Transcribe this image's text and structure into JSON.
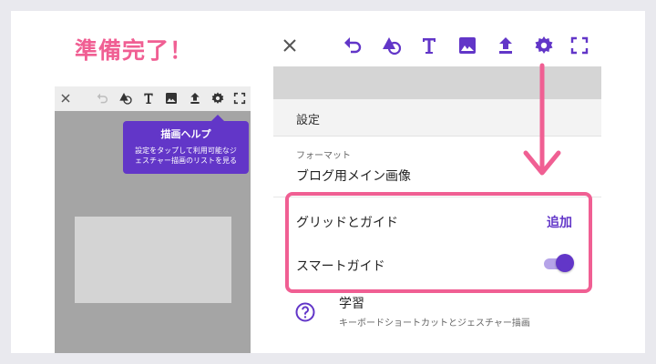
{
  "headline": "準備完了！",
  "tooltip": {
    "title": "描画ヘルプ",
    "line1": "設定をタップして利用可能なジ",
    "line2": "ェスチャー描画のリストを見る"
  },
  "toolbar_icons": [
    "close-icon",
    "undo-icon",
    "shapes-icon",
    "text-icon",
    "image-icon",
    "upload-icon",
    "gear-icon",
    "fullscreen-icon"
  ],
  "settings": {
    "section_title": "設定",
    "format_label": "フォーマット",
    "format_value": "ブログ用メイン画像",
    "grid_label": "グリッドとガイド",
    "grid_action": "追加",
    "smart_guides_label": "スマートガイド",
    "smart_guides_on": true,
    "help_title": "学習",
    "help_subtitle": "キーボードショートカットとジェスチャー描画"
  },
  "colors": {
    "accent": "#6236c8",
    "highlight": "#f05f93",
    "headline": "#f05f93"
  }
}
